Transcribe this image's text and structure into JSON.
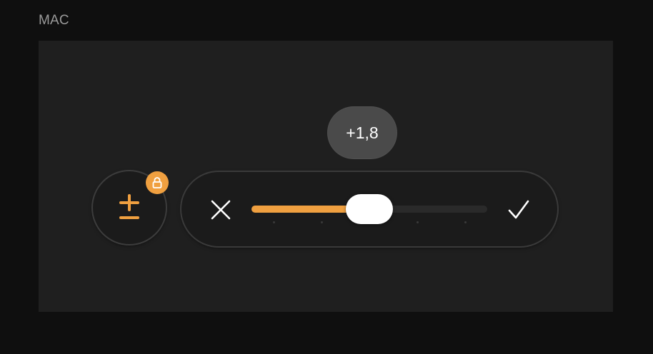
{
  "platform_label": "MAC",
  "exposure": {
    "value_label": "+1,8",
    "slider_fraction": 0.5
  },
  "icons": {
    "exposure": "plus-minus-icon",
    "lock": "lock-icon",
    "cancel": "close-icon",
    "confirm": "checkmark-icon"
  },
  "colors": {
    "accent": "#f0a040",
    "background": "#0f0f0f",
    "panel": "#1f1f1f",
    "bubble": "#4a4a4a"
  }
}
